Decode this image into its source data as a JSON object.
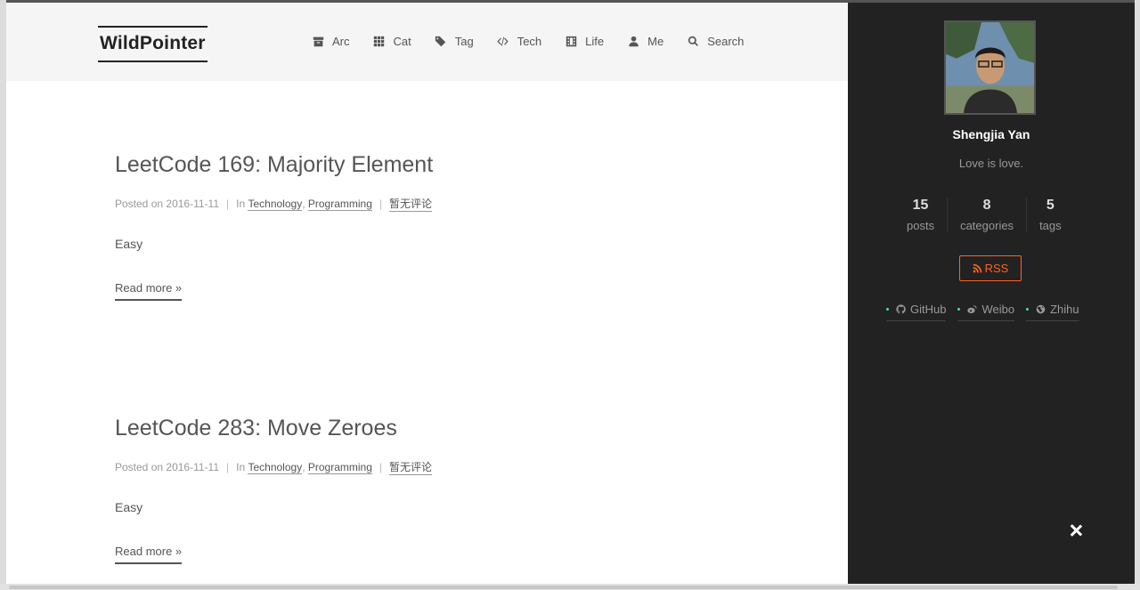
{
  "site": {
    "brand": "WildPointer"
  },
  "menu": [
    {
      "label": "Arc",
      "icon": "archive-icon"
    },
    {
      "label": "Cat",
      "icon": "grid-icon"
    },
    {
      "label": "Tag",
      "icon": "tags-icon"
    },
    {
      "label": "Tech",
      "icon": "code-icon"
    },
    {
      "label": "Life",
      "icon": "film-icon"
    },
    {
      "label": "Me",
      "icon": "user-icon"
    },
    {
      "label": "Search",
      "icon": "search-icon"
    }
  ],
  "posts": [
    {
      "title": "LeetCode 169: Majority Element",
      "posted_on_label": "Posted on",
      "date": "2016-11-11",
      "in_label": "In",
      "categories": [
        "Technology",
        "Programming"
      ],
      "comments": "暂无评论",
      "excerpt": "Easy",
      "read_more": "Read more »"
    },
    {
      "title": "LeetCode 283: Move Zeroes",
      "posted_on_label": "Posted on",
      "date": "2016-11-11",
      "in_label": "In",
      "categories": [
        "Technology",
        "Programming"
      ],
      "comments": "暂无评论",
      "excerpt": "Easy",
      "read_more": "Read more »"
    }
  ],
  "sidebar": {
    "author": "Shengjia Yan",
    "motto": "Love is love.",
    "stats": [
      {
        "count": "15",
        "label": "posts"
      },
      {
        "count": "8",
        "label": "categories"
      },
      {
        "count": "5",
        "label": "tags"
      }
    ],
    "rss_label": "RSS",
    "links": [
      {
        "label": "GitHub",
        "icon": "github-icon"
      },
      {
        "label": "Weibo",
        "icon": "weibo-icon"
      },
      {
        "label": "Zhihu",
        "icon": "globe-icon"
      }
    ]
  },
  "colors": {
    "sidebar_bg": "#222222",
    "header_bg": "#f5f5f5",
    "rss_accent": "#fc6423",
    "link_dot": "#4dde9b"
  }
}
